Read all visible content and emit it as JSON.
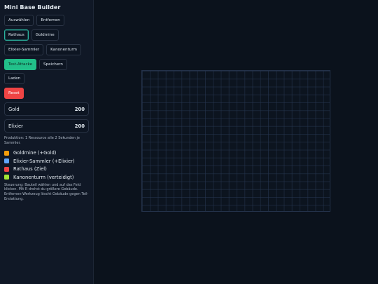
{
  "sidebar": {
    "title": "Mini Base Builder",
    "tools": {
      "select": "Auswählen",
      "remove": "Entfernen"
    },
    "buildings": {
      "townhall": "Rathaus",
      "goldmine": "Goldmine",
      "elixir": "Elixier-Sammler",
      "cannon": "Kanonenturm"
    },
    "actions": {
      "attack": "Test-Attacke",
      "save": "Speichern",
      "load": "Laden"
    },
    "reset": "Reset",
    "resources": [
      {
        "label": "Gold",
        "value": "200"
      },
      {
        "label": "Elixier",
        "value": "200"
      }
    ],
    "production_note": "Produktion: 1 Ressource alle 2 Sekunden je Sammler.",
    "legend": [
      {
        "label": "Goldmine (+Gold)",
        "color": "#f59e0b"
      },
      {
        "label": "Elixier-Sammler (+Elixier)",
        "color": "#60a5fa"
      },
      {
        "label": "Rathaus (Ziel)",
        "color": "#ef4444"
      },
      {
        "label": "Kanonenturm (verteidigt)",
        "color": "#a3e635"
      }
    ],
    "help": "Steuerung: Bauteil wählen und auf das Feld klicken. Mit  R  drehst du größere Gebäude. Entfernen-Werkzeug löscht Gebäude gegen Teil-Erstattung."
  },
  "colors": {
    "accent": "#2bb4a0",
    "attack": "#22c08a",
    "reset": "#ef4444"
  }
}
